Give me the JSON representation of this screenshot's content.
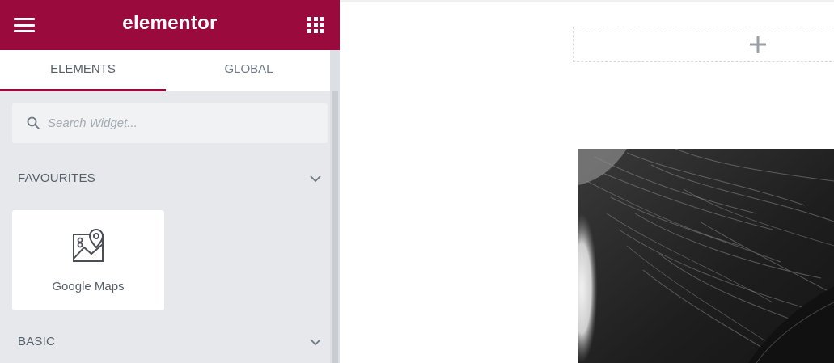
{
  "header": {
    "logo_text": "elementor",
    "brand_color": "#9b0a3d",
    "menu_icon": "hamburger-icon",
    "apps_icon": "grid-icon"
  },
  "tabs": [
    {
      "label": "ELEMENTS",
      "active": true
    },
    {
      "label": "GLOBAL",
      "active": false
    }
  ],
  "search": {
    "placeholder": "Search Widget...",
    "icon": "search-icon"
  },
  "sections": {
    "favourites": {
      "label": "FAVOURITES",
      "icon": "chevron-down-icon"
    },
    "basic": {
      "label": "BASIC",
      "icon": "chevron-down-icon"
    }
  },
  "widgets": [
    {
      "label": "Google Maps",
      "icon": "map-pin-icon"
    }
  ],
  "canvas": {
    "add_section_icon": "plus-icon"
  }
}
